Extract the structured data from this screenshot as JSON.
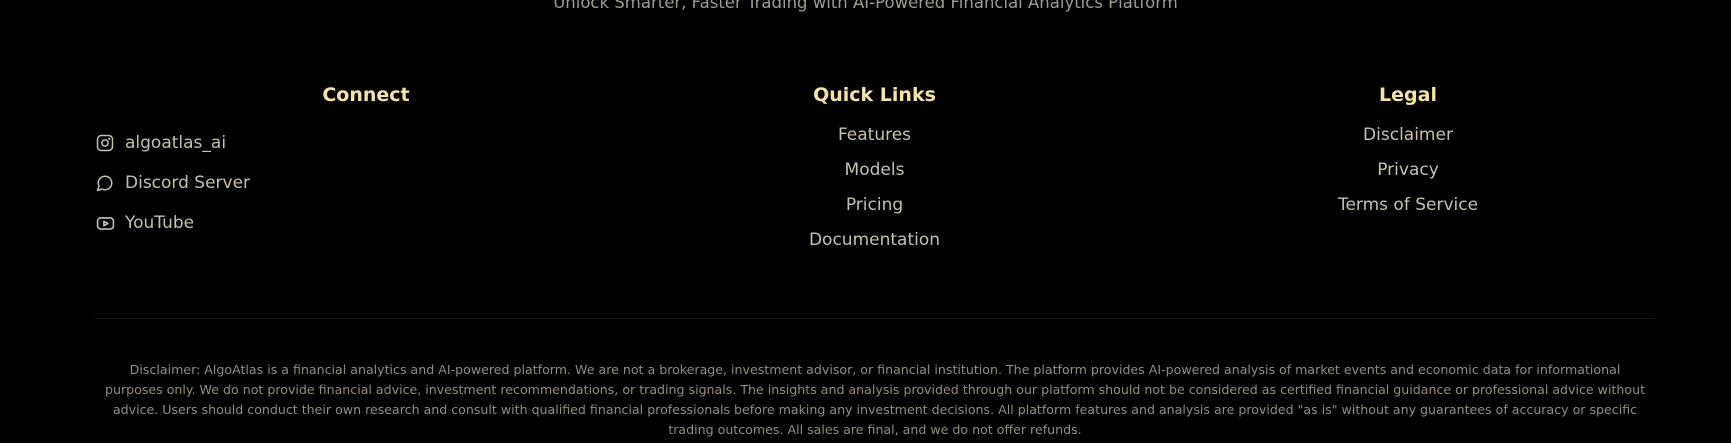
{
  "tagline": "Unlock Smarter, Faster Trading with AI-Powered Financial Analytics Platform",
  "connect": {
    "heading": "Connect",
    "items": [
      {
        "label": "algoatlas_ai",
        "icon": "instagram-icon"
      },
      {
        "label": "Discord Server",
        "icon": "chat-bubble-icon"
      },
      {
        "label": "YouTube",
        "icon": "youtube-icon"
      }
    ]
  },
  "quick_links": {
    "heading": "Quick Links",
    "items": [
      "Features",
      "Models",
      "Pricing",
      "Documentation"
    ]
  },
  "legal": {
    "heading": "Legal",
    "items": [
      "Disclaimer",
      "Privacy",
      "Terms of Service"
    ]
  },
  "disclaimer": "Disclaimer: AlgoAtlas is a financial analytics and AI-powered platform. We are not a brokerage, investment advisor, or financial institution. The platform provides AI-powered analysis of market events and economic data for informational purposes only. We do not provide financial advice, investment recommendations, or trading signals. The insights and analysis provided through our platform should not be considered as certified financial guidance or professional advice without advice. Users should conduct their own research and consult with qualified financial professionals before making any investment decisions. All platform features and analysis are provided \"as is\" without any guarantees of accuracy or specific trading outcomes. All sales are final, and we do not offer refunds.",
  "colors": {
    "background": "#000000",
    "heading": "#f5e3a6",
    "link": "#c8c0ad",
    "muted": "#948d7c"
  }
}
